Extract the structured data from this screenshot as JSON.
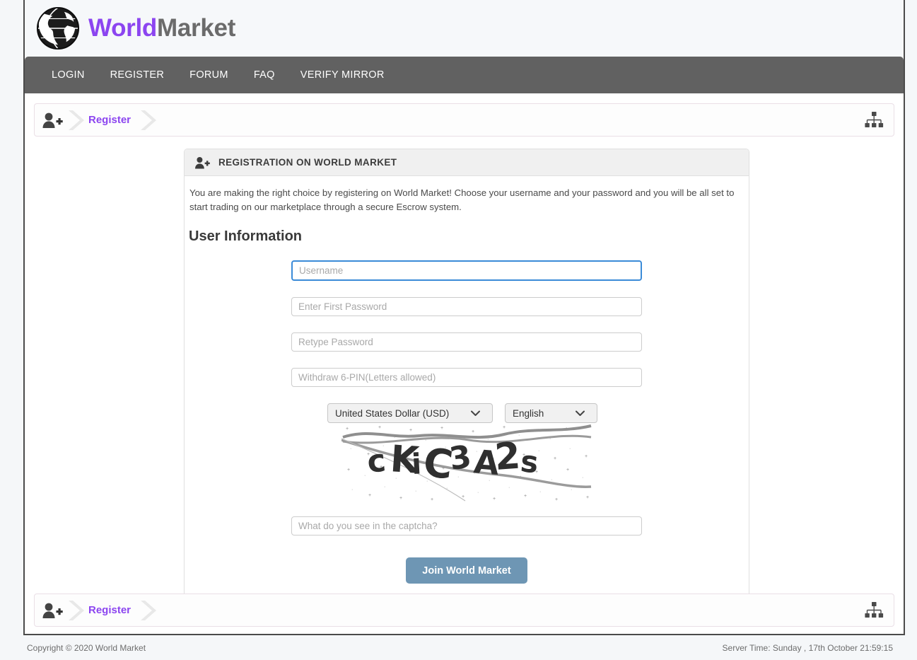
{
  "brand": {
    "part1": "World",
    "part2": "Market",
    "logo_icon": "globe-icon",
    "accent_color": "#8c45f0",
    "secondary_color": "#6b6b6b"
  },
  "nav": {
    "items": [
      {
        "label": "LOGIN",
        "name": "nav-item-login"
      },
      {
        "label": "REGISTER",
        "name": "nav-item-register"
      },
      {
        "label": "FORUM",
        "name": "nav-item-forum"
      },
      {
        "label": "FAQ",
        "name": "nav-item-faq"
      },
      {
        "label": "VERIFY MIRROR",
        "name": "nav-item-verify-mirror"
      }
    ],
    "background_color": "#616161"
  },
  "breadcrumb": {
    "home_icon": "user-add-icon",
    "separator_icon": "chevron-right-icon",
    "current": "Register",
    "right_icon": "sitemap-icon",
    "link_color": "#8c45f0"
  },
  "panel": {
    "header_icon": "user-add-icon",
    "title": "REGISTRATION ON WORLD MARKET",
    "intro": "You are making the right choice by registering on World Market! Choose your username and your password and you will be all set to start trading on our marketplace through a secure Escrow system.",
    "section_title": "User Information"
  },
  "form": {
    "username": {
      "value": "",
      "placeholder": "Username",
      "focused": true
    },
    "password1": {
      "value": "",
      "placeholder": "Enter First Password"
    },
    "password2": {
      "value": "",
      "placeholder": "Retype Password"
    },
    "pin": {
      "value": "",
      "placeholder": "Withdraw 6-PIN(Letters allowed)"
    },
    "currency": {
      "selected": "United States Dollar (USD)",
      "chevron_icon": "chevron-down-icon"
    },
    "language": {
      "selected": "English",
      "chevron_icon": "chevron-down-icon"
    },
    "captcha": {
      "text": "cKiC3A2s",
      "alt": "captcha-image"
    },
    "captcha_answer": {
      "value": "",
      "placeholder": "What do you see in the captcha?"
    },
    "submit_label": "Join World Market",
    "submit_color": "#6e96b4"
  },
  "footer": {
    "copyright": "Copyright © 2020 World Market",
    "server_time": "Server Time: Sunday , 17th October 21:59:15"
  }
}
